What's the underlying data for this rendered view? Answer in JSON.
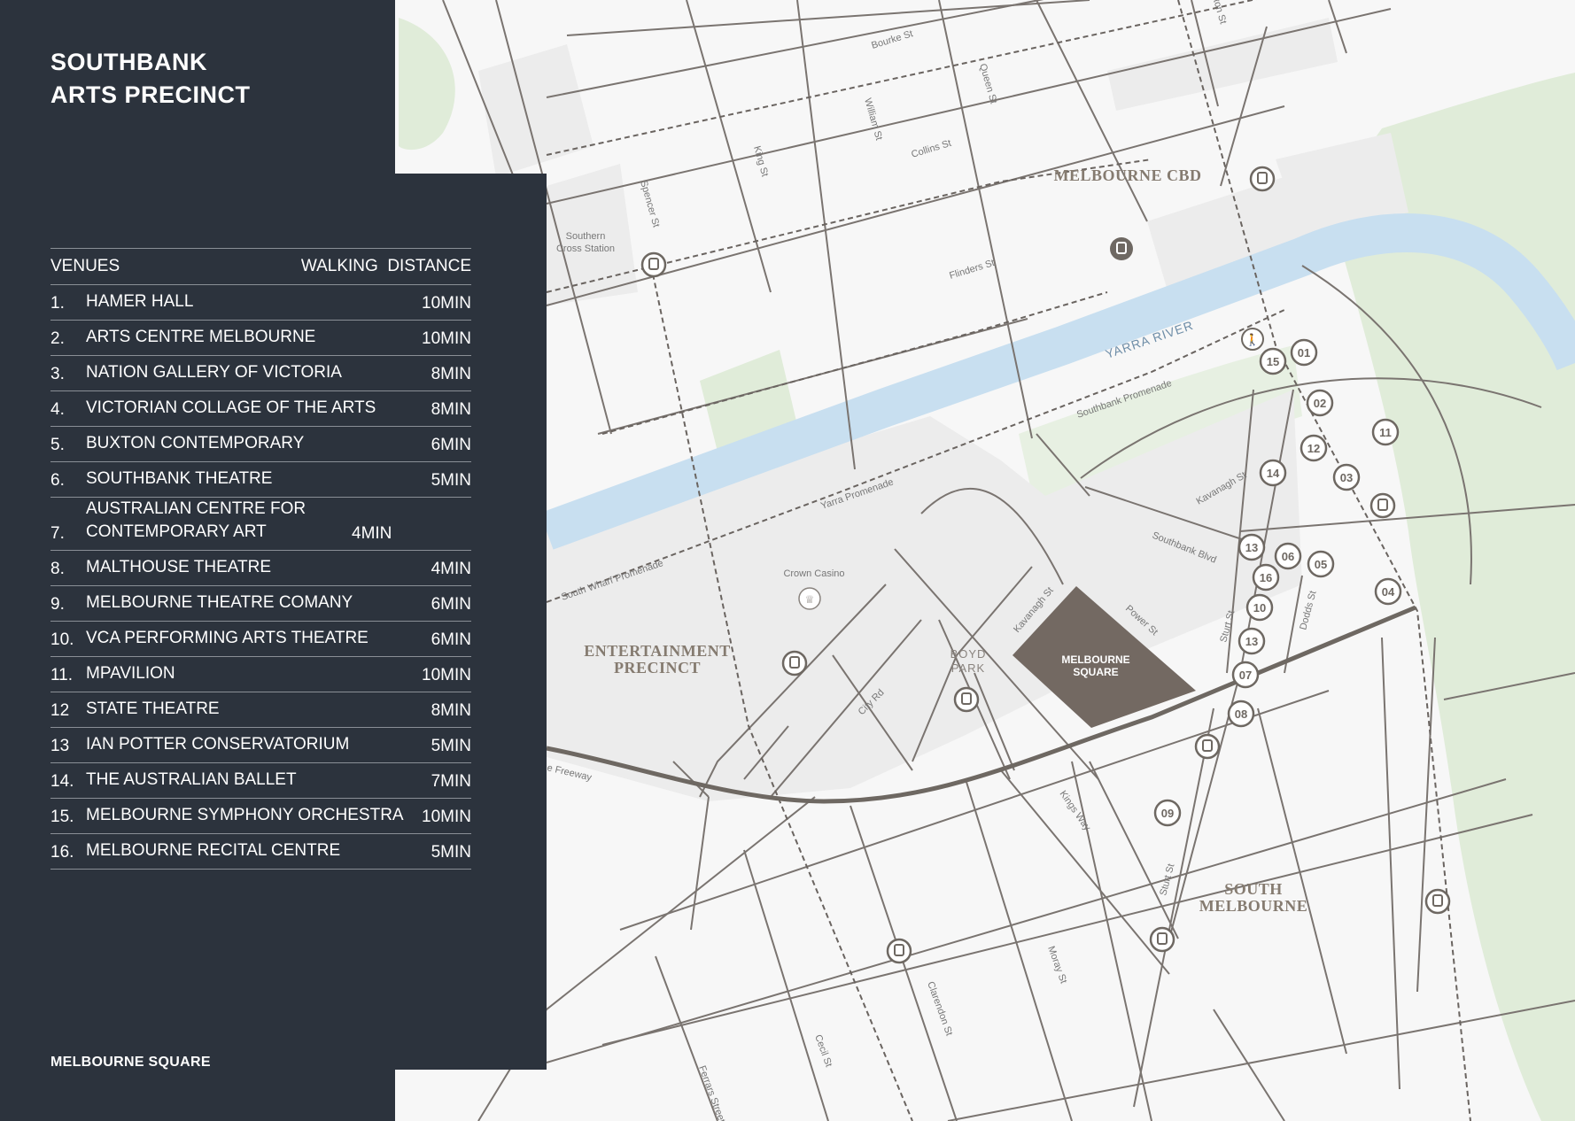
{
  "title": {
    "line1": "SOUTHBANK",
    "line2": "ARTS PRECINCT"
  },
  "table": {
    "header_venues": "VENUES",
    "header_distance": "WALKING  DISTANCE",
    "rows": [
      {
        "num": "1.",
        "name": "HAMER HALL",
        "time": "10MIN"
      },
      {
        "num": "2.",
        "name": "ARTS CENTRE MELBOURNE",
        "time": "10MIN"
      },
      {
        "num": "3.",
        "name": "NATION GALLERY OF VICTORIA",
        "time": "8MIN"
      },
      {
        "num": "4.",
        "name": "VICTORIAN COLLAGE OF THE ARTS",
        "time": "8MIN"
      },
      {
        "num": "5.",
        "name": "BUXTON CONTEMPORARY",
        "time": "6MIN"
      },
      {
        "num": "6.",
        "name": "SOUTHBANK THEATRE",
        "time": "5MIN"
      },
      {
        "num": "7.",
        "name": "AUSTRALIAN CENTRE FOR CONTEMPORARY ART",
        "time": "4MIN"
      },
      {
        "num": "8.",
        "name": "MALTHOUSE THEATRE",
        "time": "4MIN"
      },
      {
        "num": "9.",
        "name": "MELBOURNE THEATRE COMANY",
        "time": "6MIN"
      },
      {
        "num": "10.",
        "name": "VCA PERFORMING ARTS THEATRE",
        "time": "6MIN"
      },
      {
        "num": "11.",
        "name": "MPAVILION",
        "time": "10MIN"
      },
      {
        "num": "12",
        "name": "STATE THEATRE",
        "time": "8MIN"
      },
      {
        "num": "13",
        "name": "IAN POTTER CONSERVATORIUM",
        "time": "5MIN"
      },
      {
        "num": "14.",
        "name": "THE AUSTRALIAN BALLET",
        "time": "7MIN"
      },
      {
        "num": "15.",
        "name": "MELBOURNE SYMPHONY ORCHESTRA",
        "time": "10MIN"
      },
      {
        "num": "16.",
        "name": "MELBOURNE RECITAL CENTRE",
        "time": "5MIN"
      }
    ]
  },
  "footer": "MELBOURNE SQUARE",
  "map": {
    "districts": {
      "cbd": "MELBOURNE CBD",
      "ent1": "ENTERTAINMENT",
      "ent2": "PRECINCT",
      "sm1": "SOUTH",
      "sm2": "MELBOURNE",
      "boyd1": "BOYD",
      "boyd2": "PARK",
      "ms1": "MELBOURNE",
      "ms2": "SQUARE"
    },
    "river": "YARRA RIVER",
    "streets": {
      "bourke": "Bourke St",
      "collins": "Collins St",
      "flinders": "Flinders St",
      "queen": "Queen St",
      "william": "William St",
      "king": "King St",
      "spencer": "Spencer St",
      "elizabeth": "ton St",
      "southbank_prom": "Southbank Promenade",
      "yarra_prom": "Yarra Promenade",
      "south_wharf": "South Wharf Promenade",
      "kavanagh1": "Kavanagh St",
      "kavanagh2": "Kavanagh St",
      "southbank_blvd": "Southbank Blvd",
      "power": "Power St",
      "sturt1": "Sturt St",
      "sturt2": "Sturt St",
      "dodds": "Dodds St",
      "city_rd": "City Rd",
      "kings_way": "Kings Way",
      "freeway": "e Freeway",
      "moray": "Moray St",
      "clarendon": "Clarendon St",
      "cecil": "Cecil St",
      "ferrars": "Ferrars Street"
    },
    "places": {
      "southern1": "Southern",
      "southern2": "Cross Station",
      "casino": "Crown Casino"
    },
    "badges": [
      "01",
      "02",
      "03",
      "04",
      "05",
      "06",
      "07",
      "08",
      "09",
      "10",
      "11",
      "12",
      "13",
      "13",
      "14",
      "15",
      "16"
    ],
    "colors": {
      "panel": "#2c333d",
      "river": "#c8dff0",
      "park": "#e0ecd9",
      "block": "#ededed",
      "square": "#736962"
    }
  }
}
